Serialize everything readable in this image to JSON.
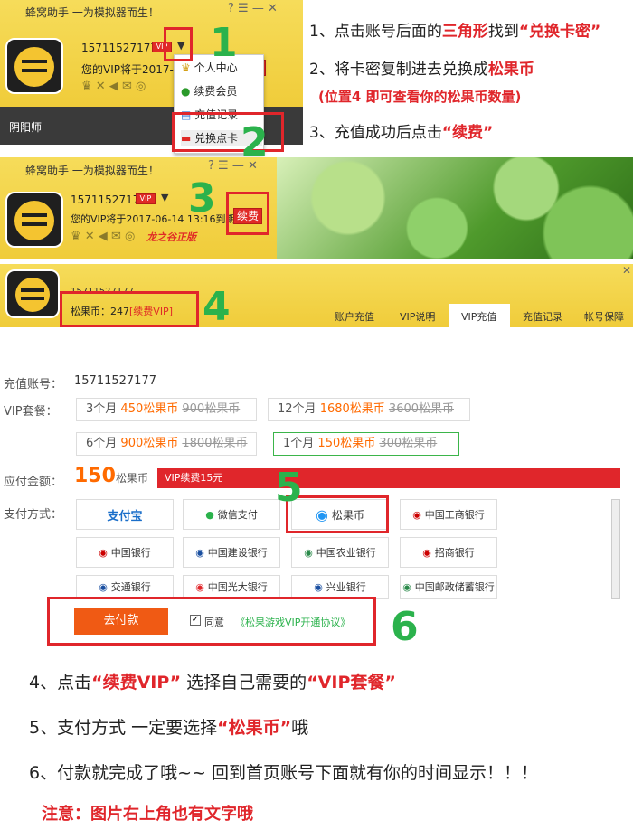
{
  "panel1": {
    "title": "蜂窝助手 一为模拟器而生！",
    "account": "15711527177",
    "vip_badge": "VIP",
    "expire": "您的VIP将于2017-0",
    "renew": "续费",
    "city": "阴阳师",
    "menu": [
      "个人中心",
      "续费会员",
      "充值记录",
      "兑换点卡"
    ]
  },
  "panel2": {
    "title": "蜂窝助手 一为模拟器而生！",
    "account": "15711527177",
    "vip_badge": "VIP",
    "expire": "您的VIP将于2017-06-14 13:16到期",
    "renew": "续费",
    "promo": "龙之谷正版"
  },
  "panel3": {
    "account": "15711527177",
    "coins": "松果币：247",
    "vip_link": "[续费VIP]",
    "tabs": [
      "账户充值",
      "VIP说明",
      "VIP充值",
      "充值记录",
      "帐号保障"
    ],
    "recharge_label": "充值账号：",
    "recharge_value": "15711527177",
    "vip_pkg_label": "VIP套餐：",
    "packages": [
      {
        "m": "3个月",
        "p": "450松果币",
        "o": "900松果币"
      },
      {
        "m": "12个月",
        "p": "1680松果币",
        "o": "3600松果币"
      },
      {
        "m": "6个月",
        "p": "900松果币",
        "o": "1800松果币"
      },
      {
        "m": "1个月",
        "p": "150松果币",
        "o": "300松果币"
      }
    ],
    "amount_label": "应付金额：",
    "amount": "150",
    "amount_unit": "松果币",
    "amount_bar": "VIP续费15元",
    "pay_label": "支付方式：",
    "methods": [
      "支付宝",
      "微信支付",
      "松果币",
      "中国工商银行",
      "中国银行",
      "中国建设银行",
      "中国农业银行",
      "招商银行",
      "交通银行",
      "中国光大银行",
      "兴业银行",
      "中国邮政储蓄银行"
    ],
    "pay_btn": "去付款",
    "agree": "同意",
    "agreement": "《松果游戏VIP开通协议》"
  },
  "steps_top": [
    "1、点击账号后面的",
    "三角形",
    "找到",
    "“兑换卡密”",
    "2、将卡密复制进去兑换成",
    "松果币",
    "(位置4 即可查看你的松果币数量)",
    "3、充值成功后点击",
    "“续费”"
  ],
  "numbers": [
    "1",
    "2",
    "3",
    "4",
    "5",
    "6"
  ],
  "steps_bottom": [
    "4、点击",
    "“续费VIP”",
    "选择自己需要的",
    "“VIP套餐”",
    "5、支付方式 一定要选择",
    "“松果币”",
    "哦",
    "6、付款就完成了哦~~ 回到首页账号下面就有你的时间显示！！！",
    "注意：图片右上角也有文字哦"
  ]
}
